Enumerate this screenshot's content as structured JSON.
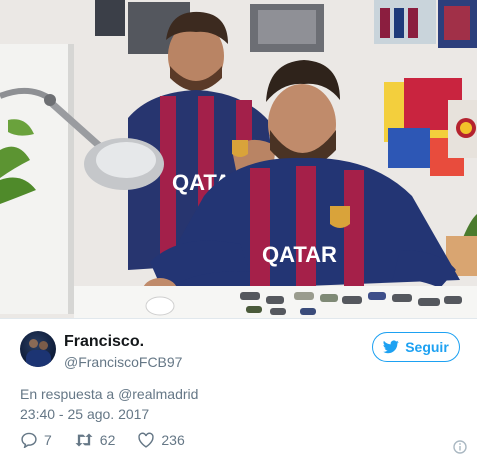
{
  "photo": {
    "description_icon": "photo-image",
    "jersey_text": "QATAR"
  },
  "tweet": {
    "display_name": "Francisco.",
    "handle": "@FranciscoFCB97",
    "follow_label": "Seguir",
    "reply_prefix": "En respuesta a",
    "reply_to": "@realmadrid",
    "timestamp": "23:40 - 25 ago. 2017",
    "replies": "7",
    "retweets": "62",
    "likes": "236"
  },
  "icons": {
    "follow": "twitter-bird-icon",
    "reply": "reply-icon",
    "retweet": "retweet-icon",
    "like": "heart-icon",
    "info": "info-icon"
  },
  "colors": {
    "accent": "#1da1f2",
    "muted": "#657786",
    "text": "#14171a"
  }
}
